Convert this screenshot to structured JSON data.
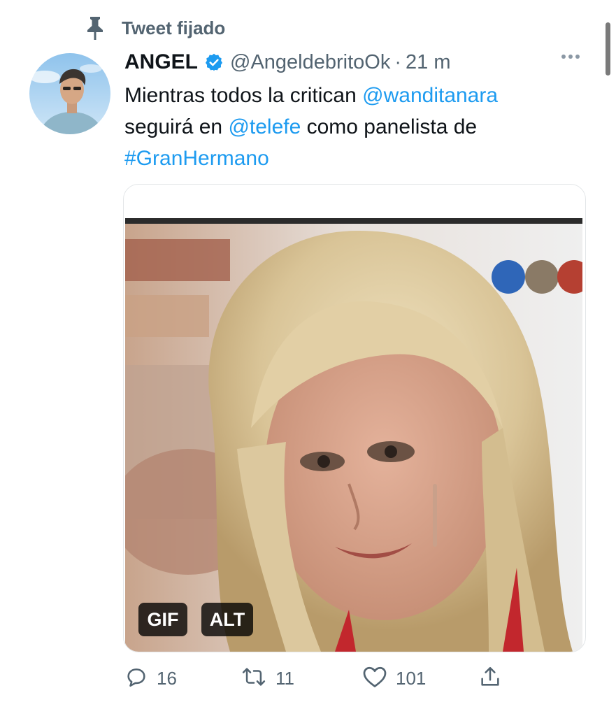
{
  "pinned": {
    "label": "Tweet fijado",
    "icon": "pin-icon"
  },
  "author": {
    "name": "ANGEL",
    "verified": true,
    "handle": "@AngeldebritoOk",
    "separator": "·",
    "time": "21 m"
  },
  "tweet": {
    "segments": [
      {
        "text": "Mientras todos la critican ",
        "type": "text"
      },
      {
        "text": "@wanditanara",
        "type": "mention"
      },
      {
        "text": " seguirá en ",
        "type": "text"
      },
      {
        "text": "@telefe",
        "type": "mention"
      },
      {
        "text": " como panelista de ",
        "type": "text"
      },
      {
        "text": "#GranHermano",
        "type": "hashtag"
      }
    ]
  },
  "media": {
    "type": "gif",
    "badges": {
      "gif": "GIF",
      "alt": "ALT"
    }
  },
  "actions": {
    "reply": {
      "icon": "reply-icon",
      "count": "16"
    },
    "retweet": {
      "icon": "retweet-icon",
      "count": "11"
    },
    "like": {
      "icon": "heart-icon",
      "count": "101"
    },
    "share": {
      "icon": "share-icon"
    }
  },
  "colors": {
    "accent": "#1d9bf0",
    "secondary_text": "#536471",
    "primary_text": "#0f1419",
    "verified": "#1d9bf0"
  }
}
